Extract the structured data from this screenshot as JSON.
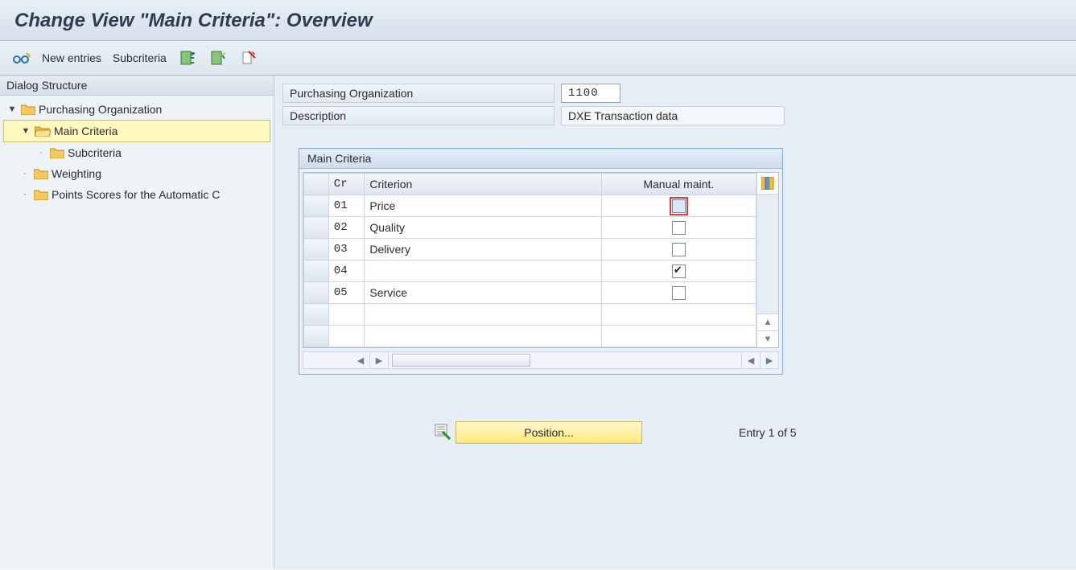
{
  "title": "Change View \"Main Criteria\": Overview",
  "toolbar": {
    "new_entries": "New entries",
    "subcriteria": "Subcriteria"
  },
  "sidebar": {
    "header": "Dialog Structure",
    "items": [
      {
        "label": "Purchasing Organization",
        "level": 0,
        "expander": "▼",
        "selected": false,
        "open": true
      },
      {
        "label": "Main Criteria",
        "level": 1,
        "expander": "▼",
        "selected": true,
        "open": true
      },
      {
        "label": "Subcriteria",
        "level": 2,
        "expander": "·",
        "selected": false,
        "open": false
      },
      {
        "label": "Weighting",
        "level": 1,
        "expander": "·",
        "selected": false,
        "open": false
      },
      {
        "label": "Points Scores for the Automatic C",
        "level": 1,
        "expander": "·",
        "selected": false,
        "open": false
      }
    ]
  },
  "header_fields": {
    "purch_org_label": "Purchasing Organization",
    "purch_org_value": "1100",
    "description_label": "Description",
    "description_value": "DXE Transaction data"
  },
  "table": {
    "title": "Main Criteria",
    "columns": {
      "cr": "Cr",
      "criterion": "Criterion",
      "manual": "Manual maint."
    },
    "rows": [
      {
        "cr": "01",
        "criterion": "Price",
        "manual": false,
        "focused": true
      },
      {
        "cr": "02",
        "criterion": "Quality",
        "manual": false,
        "focused": false
      },
      {
        "cr": "03",
        "criterion": "Delivery",
        "manual": false,
        "focused": false
      },
      {
        "cr": "04",
        "criterion": "",
        "manual": true,
        "focused": false
      },
      {
        "cr": "05",
        "criterion": "Service",
        "manual": false,
        "focused": false
      },
      {
        "cr": "",
        "criterion": "",
        "manual": null,
        "focused": false
      },
      {
        "cr": "",
        "criterion": "",
        "manual": null,
        "focused": false
      }
    ]
  },
  "footer": {
    "position_btn": "Position...",
    "entry_text": "Entry 1 of 5"
  }
}
